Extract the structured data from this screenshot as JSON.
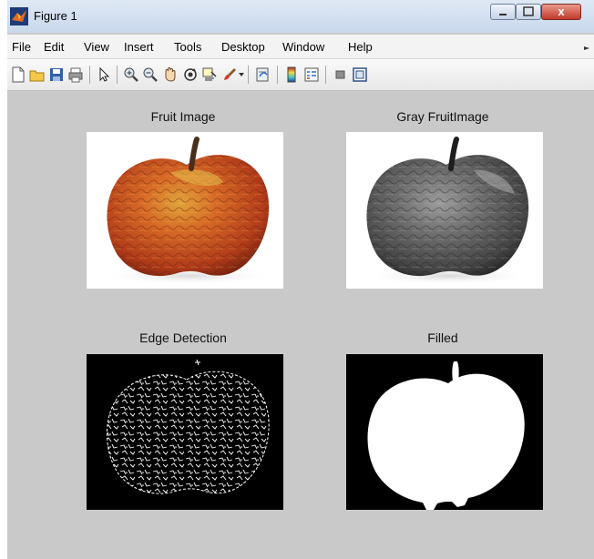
{
  "window": {
    "title": "Figure 1",
    "close_glyph": "x",
    "min_glyph": "-",
    "max_glyph": "□"
  },
  "menu": [
    "File",
    "Edit",
    "View",
    "Insert",
    "Tools",
    "Desktop",
    "Window",
    "Help"
  ],
  "toolbar_icons": [
    "new-figure-icon",
    "open-file-icon",
    "save-icon",
    "print-icon",
    "select-arrow-icon",
    "zoom-in-icon",
    "zoom-out-icon",
    "pan-hand-icon",
    "rotate-3d-icon",
    "data-cursor-icon",
    "brush-icon",
    "link-plot-icon",
    "colorbar-icon",
    "legend-icon",
    "hide-plot-tools-icon",
    "show-plot-tools-icon"
  ],
  "axes": [
    {
      "title": "Fruit Image"
    },
    {
      "title": "Gray FruitImage"
    },
    {
      "title": "Edge Detection"
    },
    {
      "title": "Filled"
    }
  ],
  "colors": {
    "figure_bg": "#c9c9c9",
    "apple_red": "#c8431e",
    "apple_yellow": "#d9a025"
  }
}
